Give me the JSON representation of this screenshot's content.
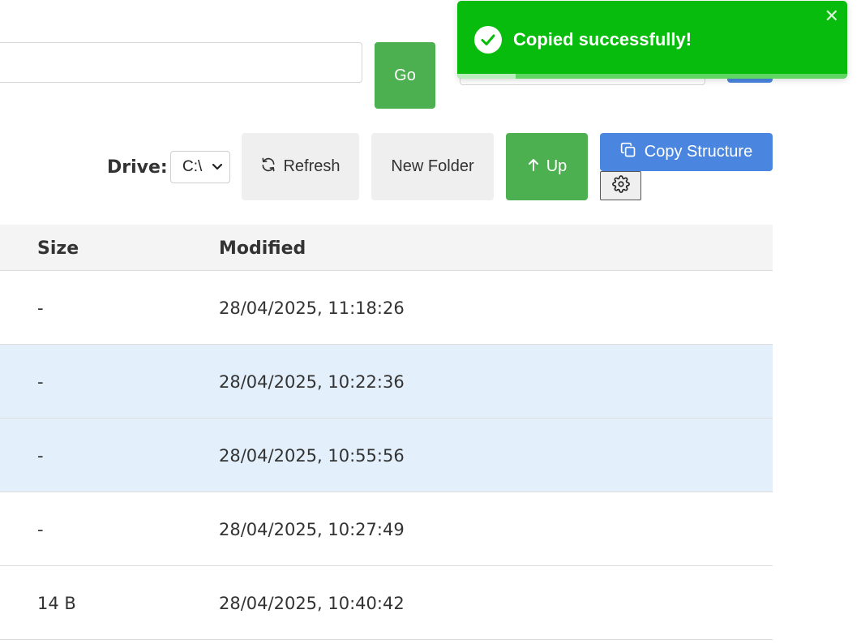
{
  "path_bar": {
    "value": "",
    "go_label": "Go"
  },
  "toolbar": {
    "drive_label": "Drive:",
    "drive_selected": "C:\\",
    "refresh_label": "Refresh",
    "new_folder_label": "New Folder",
    "up_label": "Up",
    "copy_structure_label": "Copy Structure"
  },
  "table": {
    "headers": {
      "size": "Size",
      "modified": "Modified"
    },
    "rows": [
      {
        "size": "-",
        "modified": "28/04/2025, 11:18:26",
        "selected": false
      },
      {
        "size": "-",
        "modified": "28/04/2025, 10:22:36",
        "selected": true
      },
      {
        "size": "-",
        "modified": "28/04/2025, 10:55:56",
        "selected": true
      },
      {
        "size": "-",
        "modified": "28/04/2025, 10:27:49",
        "selected": false
      },
      {
        "size": "14 B",
        "modified": "28/04/2025, 10:40:42",
        "selected": false
      }
    ]
  },
  "toast": {
    "message": "Copied successfully!",
    "close_symbol": "✕",
    "progress_remaining": 0.15
  },
  "colors": {
    "toast_success": "#07bc0c",
    "primary_green": "#4caf50",
    "primary_blue": "#4a86e0",
    "row_selected": "#e3f0fb",
    "header_bg": "#f4f4f4"
  },
  "icons": {
    "toast": "check-circle-icon",
    "refresh": "refresh-icon",
    "up": "arrow-up-icon",
    "copy": "copy-icon",
    "settings": "gear-icon",
    "select": "chevron-down-icon",
    "close": "close-icon"
  }
}
